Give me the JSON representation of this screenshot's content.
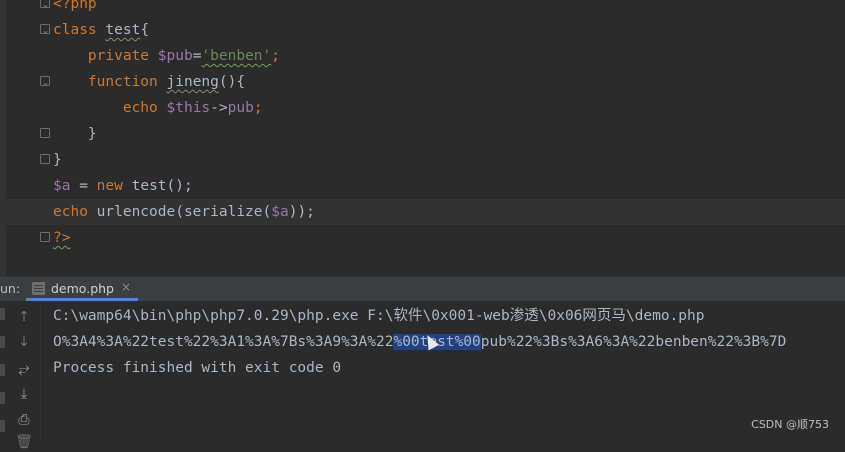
{
  "editor": {
    "lines": {
      "php_open": "<?php",
      "class_kw": "class",
      "class_name": "test",
      "class_brace": "{",
      "private_kw": "private",
      "prop_var": "$pub",
      "assign": "=",
      "prop_value": "'benben'",
      "semicolon": ";",
      "function_kw": "function",
      "method_name": "jineng",
      "method_parens": "(){",
      "echo_kw": "echo",
      "this_var": "$this",
      "arrow": "->",
      "prop_ref": "pub",
      "close_brace_inner": "}",
      "close_brace_outer": "}",
      "a_var": "$a",
      "equals": " = ",
      "new_kw": "new",
      "new_target": " test();",
      "echo2_kw": "echo",
      "echo2_call_a": " urlencode(serialize(",
      "echo2_var": "$a",
      "echo2_call_b": "));",
      "php_close": "?>"
    }
  },
  "run_panel": {
    "label": "un:",
    "tab": {
      "label": "demo.php",
      "close_icon": "×"
    }
  },
  "console": {
    "command": "C:\\wamp64\\bin\\php\\php7.0.29\\php.exe F:\\软件\\0x001-web渗透\\0x06网页马\\demo.php",
    "output_before": "O%3A4%3A%22test%22%3A1%3A%7Bs%3A9%3A%22",
    "output_selected": "%00test%00",
    "output_after": "pub%22%3Bs%3A6%3A%22benben%22%3B%7D",
    "exit_message": "Process finished with exit code 0"
  },
  "watermark": "CSDN @顺753",
  "colors": {
    "background": "#2b2b2b",
    "keyword": "#cc7832",
    "variable": "#9876aa",
    "string": "#6a8759",
    "text": "#a9b7c6",
    "selection": "#214283",
    "tab_underline": "#4a88c7"
  },
  "icons": {
    "up": "↑",
    "down": "↓",
    "wrap": "⥂",
    "scroll_end": "⤓",
    "print": "⎙",
    "delete": "🗑"
  }
}
